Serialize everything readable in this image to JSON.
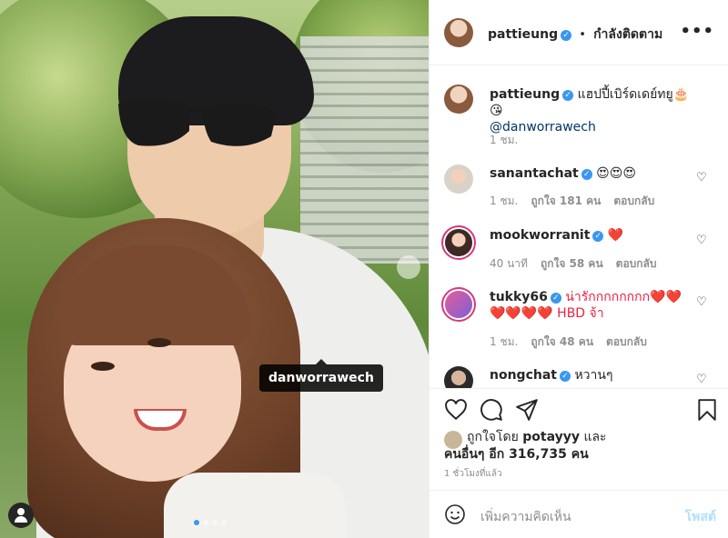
{
  "post": {
    "photo_tag": "danworrawech",
    "carousel": {
      "count": 4,
      "active": 1
    }
  },
  "header": {
    "username": "pattieung",
    "separator": "•",
    "follow_status": "กำลังติดตาม",
    "more_icon": "more-horizontal-icon"
  },
  "caption": {
    "username": "pattieung",
    "text": "แฮปปี้เบิร์ดเดย์ทยู🎂😘",
    "mention": "@danworrawech",
    "time": "1 ชม."
  },
  "comments": [
    {
      "username": "sanantachat",
      "text": "😍😍😍",
      "time": "1 ชม.",
      "likes": "ถูกใจ 181 คน",
      "reply": "ตอบกลับ"
    },
    {
      "username": "mookworranit",
      "text": "❤️",
      "time": "40 นาที",
      "likes": "ถูกใจ 58 คน",
      "reply": "ตอบกลับ"
    },
    {
      "username": "tukky66",
      "text": "น่ารักกกกกกกก❤️❤️",
      "text2": "❤️❤️❤️❤️ HBD จ้า",
      "time": "1 ชม.",
      "likes": "ถูกใจ 48 คน",
      "reply": "ตอบกลับ"
    },
    {
      "username": "nongchat",
      "text": "หวานๆ"
    }
  ],
  "actions": {
    "like_icon": "heart-icon",
    "comment_icon": "comment-icon",
    "share_icon": "send-icon",
    "save_icon": "bookmark-icon"
  },
  "likes": {
    "line1_prefix": "ถูกใจโดย",
    "user": "potayyy",
    "line1_suffix": "และ",
    "line2": "คนอื่นๆ อีก 316,735 คน"
  },
  "timestamp": "1 ชั่วโมงที่แล้ว",
  "add_comment": {
    "placeholder": "เพิ่มความคิดเห็น",
    "post_label": "โพสต์"
  },
  "colors": {
    "verified": "#3897f0",
    "link": "#003569",
    "muted": "#8e8e8e",
    "post_disabled": "#b2dffc"
  }
}
